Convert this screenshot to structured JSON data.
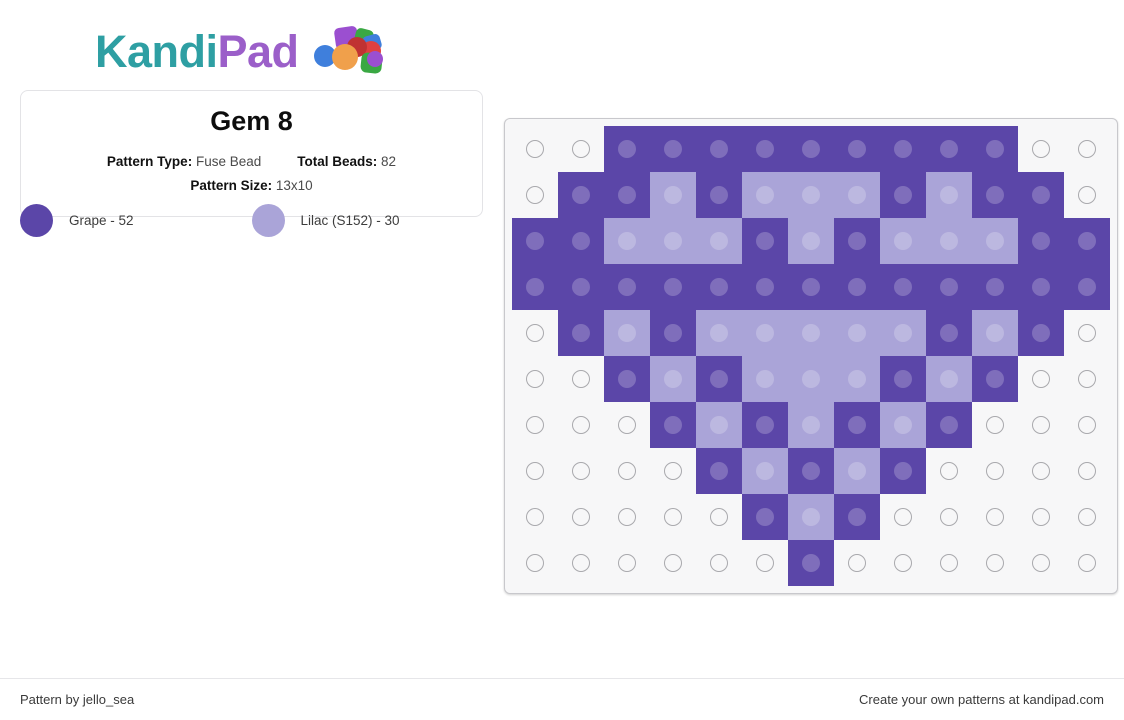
{
  "brand": {
    "name_part1": "Kandi",
    "name_part2": "Pad",
    "beads_icon": "bead-pile-icon",
    "colors": {
      "teal": "#2e9fa3",
      "purple": "#9b5fc9"
    }
  },
  "card": {
    "title": "Gem 8",
    "pattern_type_label": "Pattern Type:",
    "pattern_type_value": "Fuse Bead",
    "total_beads_label": "Total Beads:",
    "total_beads_value": "82",
    "pattern_size_label": "Pattern Size:",
    "pattern_size_value": "13x10"
  },
  "legend": [
    {
      "name": "Grape",
      "count": 52,
      "label": "Grape - 52",
      "hex": "#5b46a8"
    },
    {
      "name": "Lilac (S152)",
      "count": 30,
      "label": "Lilac (S152) - 30",
      "hex": "#aaa4d8"
    }
  ],
  "pattern": {
    "width": 13,
    "height": 10,
    "palette": {
      "G": "#5b46a8",
      "L": "#aaa4d8",
      "_": null
    },
    "empty_cell_color": "#f7f7f8",
    "grid": [
      [
        "_",
        "_",
        "G",
        "G",
        "G",
        "G",
        "G",
        "G",
        "G",
        "G",
        "G",
        "_",
        "_"
      ],
      [
        "_",
        "G",
        "G",
        "L",
        "G",
        "L",
        "L",
        "L",
        "G",
        "L",
        "G",
        "G",
        "_"
      ],
      [
        "G",
        "G",
        "L",
        "L",
        "L",
        "G",
        "L",
        "G",
        "L",
        "L",
        "L",
        "G",
        "G"
      ],
      [
        "G",
        "G",
        "G",
        "G",
        "G",
        "G",
        "G",
        "G",
        "G",
        "G",
        "G",
        "G",
        "G"
      ],
      [
        "_",
        "G",
        "L",
        "G",
        "L",
        "L",
        "L",
        "L",
        "L",
        "G",
        "L",
        "G",
        "_"
      ],
      [
        "_",
        "_",
        "G",
        "L",
        "G",
        "L",
        "L",
        "L",
        "G",
        "L",
        "G",
        "_",
        "_"
      ],
      [
        "_",
        "_",
        "_",
        "G",
        "L",
        "G",
        "L",
        "G",
        "L",
        "G",
        "_",
        "_",
        "_"
      ],
      [
        "_",
        "_",
        "_",
        "_",
        "G",
        "L",
        "G",
        "L",
        "G",
        "_",
        "_",
        "_",
        "_"
      ],
      [
        "_",
        "_",
        "_",
        "_",
        "_",
        "G",
        "L",
        "G",
        "_",
        "_",
        "_",
        "_",
        "_"
      ],
      [
        "_",
        "_",
        "_",
        "_",
        "_",
        "_",
        "G",
        "_",
        "_",
        "_",
        "_",
        "_",
        "_"
      ]
    ]
  },
  "footer": {
    "credit": "Pattern by jello_sea",
    "promo": "Create your own patterns at kandipad.com"
  }
}
